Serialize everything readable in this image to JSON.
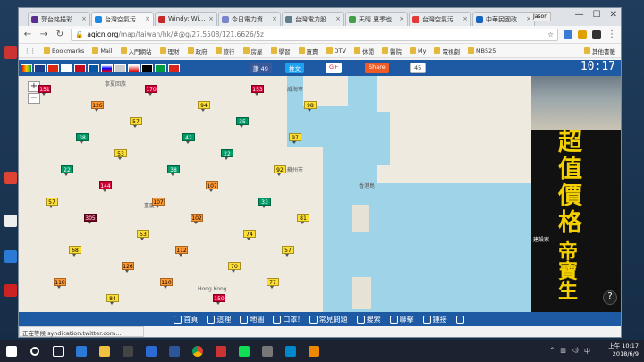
{
  "browser": {
    "tabs": [
      {
        "label": "郭台銘挹彩…",
        "color": "#5b2d8e",
        "active": false
      },
      {
        "label": "台灣空氣污…",
        "color": "#1e88e5",
        "active": true
      },
      {
        "label": "Windy: Wi…",
        "color": "#c62828",
        "active": false
      },
      {
        "label": "今日電力資…",
        "color": "#7986cb",
        "active": false
      },
      {
        "label": "台灣電力股…",
        "color": "#607d8b",
        "active": false
      },
      {
        "label": "天晴 夏季也…",
        "color": "#43a047",
        "active": false
      },
      {
        "label": "台灣空氣污…",
        "color": "#e53935",
        "active": false
      },
      {
        "label": "中華民國政…",
        "color": "#1565c0",
        "active": false
      }
    ],
    "profile": "Jason",
    "url_host": "aqicn.org",
    "url_path": "/map/taiwan/hk/#@g/27.5508/121.6626/5z",
    "bookmarks_label": "Bookmarks",
    "bookmarks": [
      "Mail",
      "入門網站",
      "理財",
      "政府",
      "旅行",
      "房屋",
      "學習",
      "買賣",
      "DTV",
      "休閒",
      "醫院",
      "My",
      "電視劇",
      "MB525"
    ],
    "bookmarks_more": "其他書籤",
    "status_text": "正在等候 syndication.twitter.com..."
  },
  "site": {
    "like_label": "讚 49",
    "share_label": "推文",
    "gplus_label": "G+",
    "share2_label": "Share",
    "share_count": "45",
    "clock": "10:17",
    "footer_nav": [
      {
        "icon": "home-icon",
        "label": "首頁"
      },
      {
        "icon": "location-icon",
        "label": "這裡"
      },
      {
        "icon": "map-icon",
        "label": "地圖"
      },
      {
        "icon": "mask-icon",
        "label": "口罩!"
      },
      {
        "icon": "faq-icon",
        "label": "常見問題"
      },
      {
        "icon": "search-icon",
        "label": "搜索"
      },
      {
        "icon": "police-icon",
        "label": "聯擊"
      },
      {
        "icon": "link-icon",
        "label": "鏈接"
      },
      {
        "icon": "gear-icon",
        "label": ""
      }
    ]
  },
  "map": {
    "labels": [
      "寧夏回族",
      "威海市",
      "香港",
      "Hong Kong",
      "重慶",
      "蘇州市",
      "香港島"
    ],
    "markers": [
      [
        "55",
        "mod"
      ],
      [
        "110",
        "usg"
      ],
      [
        "148",
        "unh"
      ],
      [
        "81",
        "mod"
      ],
      [
        "79",
        "mod"
      ],
      [
        "74",
        "mod"
      ],
      [
        "132",
        "usg"
      ],
      [
        "117",
        "usg"
      ],
      [
        "180",
        "unh"
      ],
      [
        "75",
        "mod"
      ],
      [
        "153",
        "unh"
      ],
      [
        "50",
        "good"
      ],
      [
        "104",
        "usg"
      ],
      [
        "99",
        "mod"
      ],
      [
        "108",
        "usg"
      ],
      [
        "126",
        "usg"
      ],
      [
        "159",
        "unh"
      ],
      [
        "107",
        "usg"
      ],
      [
        "114",
        "usg"
      ],
      [
        "107",
        "usg"
      ],
      [
        "83",
        "mod"
      ],
      [
        "107",
        "usg"
      ],
      [
        "74",
        "mod"
      ],
      [
        "104",
        "usg"
      ],
      [
        "152",
        "unh"
      ],
      [
        "130",
        "usg"
      ],
      [
        "109",
        "usg"
      ],
      [
        "152",
        "unh"
      ],
      [
        "163",
        "unh"
      ],
      [
        "97",
        "mod"
      ],
      [
        "104",
        "usg"
      ],
      [
        "59",
        "mod"
      ],
      [
        "93",
        "mod"
      ],
      [
        "65",
        "mod"
      ],
      [
        "119",
        "usg"
      ],
      [
        "160",
        "unh"
      ],
      [
        "151",
        "unh"
      ],
      [
        "170",
        "unh"
      ],
      [
        "153",
        "unh"
      ],
      [
        "126",
        "usg"
      ],
      [
        "94",
        "mod"
      ],
      [
        "98",
        "mod"
      ],
      [
        "57",
        "mod"
      ],
      [
        "35",
        "good"
      ],
      [
        "38",
        "good"
      ],
      [
        "42",
        "good"
      ],
      [
        "97",
        "mod"
      ],
      [
        "53",
        "mod"
      ],
      [
        "22",
        "good"
      ],
      [
        "22",
        "good"
      ],
      [
        "38",
        "good"
      ],
      [
        "92",
        "mod"
      ],
      [
        "144",
        "unh"
      ],
      [
        "107",
        "usg"
      ],
      [
        "57",
        "mod"
      ],
      [
        "107",
        "usg"
      ],
      [
        "33",
        "good"
      ],
      [
        "305",
        "haz"
      ],
      [
        "102",
        "usg"
      ],
      [
        "81",
        "mod"
      ],
      [
        "53",
        "mod"
      ],
      [
        "74",
        "mod"
      ],
      [
        "68",
        "mod"
      ],
      [
        "112",
        "usg"
      ],
      [
        "57",
        "mod"
      ],
      [
        "126",
        "usg"
      ],
      [
        "70",
        "mod"
      ],
      [
        "118",
        "usg"
      ],
      [
        "110",
        "usg"
      ],
      [
        "77",
        "mod"
      ],
      [
        "84",
        "mod"
      ],
      [
        "150",
        "unh"
      ]
    ]
  },
  "ad": {
    "headline": "超值價格",
    "brand": "建設家",
    "name": "帝寶生",
    "help": "?"
  },
  "taskbar": {
    "time": "上午 10:17",
    "date": "2018/6/9"
  }
}
